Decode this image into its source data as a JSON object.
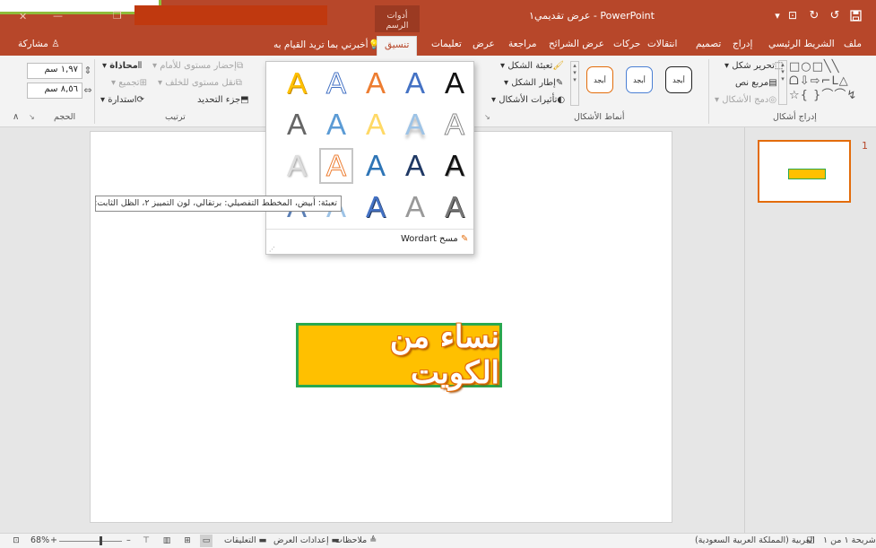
{
  "titlebar": {
    "title": "عرض تقديمي١ - PowerPoint",
    "context_tab": "أدوات الرسم",
    "quick_access": {
      "save": "save-icon",
      "undo": "undo-icon",
      "redo": "redo-icon",
      "present": "present-icon"
    },
    "window_controls": {
      "minimize": "—",
      "restore": "❐",
      "close": "✕"
    }
  },
  "tabs": [
    "ملف",
    "الشريط الرئيسي",
    "إدراج",
    "تصميم",
    "انتقالات",
    "حركات",
    "عرض الشرائح",
    "مراجعة",
    "عرض",
    "تعليمات",
    "تنسيق"
  ],
  "tell_me": "أخبرني بما تريد القيام به",
  "share": "مشاركة",
  "ribbon": {
    "insert_shapes": {
      "label": "إدراج أشكال",
      "edit_shape": "تحرير شكل",
      "text_box": "مربع نص",
      "merge_shapes": "دمج الأشكال"
    },
    "shape_styles": {
      "label": "أنماط الأشكال",
      "style_text": "أبجد",
      "fill": "تعبئة الشكل",
      "outline": "إطار الشكل",
      "effects": "تأثيرات الأشكال"
    },
    "arrange": {
      "label": "ترتيب",
      "bring_forward": "إحضار مستوى للأمام",
      "send_backward": "نقل مستوى للخلف",
      "selection_pane": "جزء التحديد",
      "align": "محاذاة",
      "group": "تجميع",
      "rotate": "استدارة"
    },
    "size": {
      "label": "الحجم",
      "height": "١,٩٧ سم",
      "width": "٨,٥٦ سم"
    }
  },
  "slide": {
    "wordart_text": "نساء من الكويت"
  },
  "thumbnails": {
    "number": "1"
  },
  "gallery": {
    "clear": "مسح Wordart",
    "tooltip": "تعبئة: أبيض، المخطط التفصيلي: برتقالي، لون التمييز ٢، الظل الثابت: برتقالي"
  },
  "statusbar": {
    "slide_count": "شريحة ١ من ١",
    "language": "العربية (المملكة العربية السعودية)",
    "notes": "ملاحظات",
    "display_settings": "إعدادات العرض",
    "comments": "التعليقات",
    "zoom": "68%"
  },
  "colors": {
    "accent": "#b7472a",
    "wordart_fill": "#ffc000",
    "wordart_border": "#2aa84f",
    "selection": "#e36c0a"
  }
}
